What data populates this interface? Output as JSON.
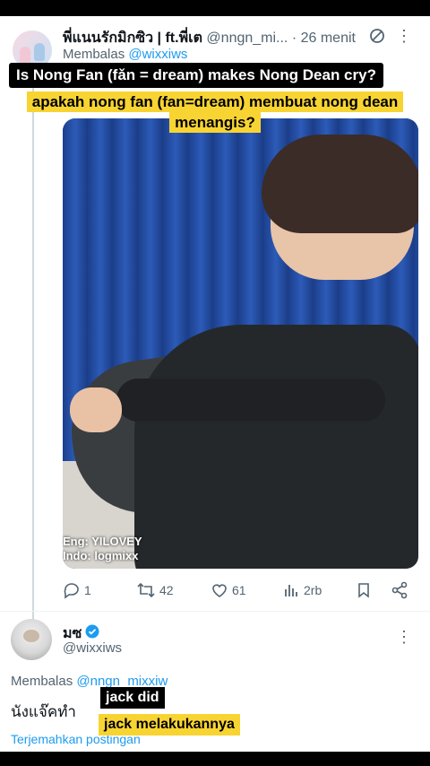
{
  "tweet1": {
    "display_name": "พี่แนนรักมิกซิว | ft.พี่เต",
    "handle": "@nngn_mi...",
    "time": "· 26 menit",
    "replying_prefix": "Membalas",
    "replying_to": "@wixxiws",
    "media_watermark_line1": "Eng: YILOVEY",
    "media_watermark_line2": "Indo: logmixx",
    "stats": {
      "replies": "1",
      "retweets": "42",
      "likes": "61",
      "views": "2rb"
    }
  },
  "captions": {
    "english_top": "Is Nong Fan (fǎn = dream) makes Nong Dean cry?",
    "indo_top_line1": "apakah nong fan (fan=dream) membuat nong dean",
    "indo_top_line2": "menangis?",
    "english_bottom": "jack did",
    "indo_bottom": "jack melakukannya"
  },
  "tweet2": {
    "display_name": "มซ",
    "handle": "@wixxiws",
    "replying_prefix": "Membalas",
    "replying_to": "@nngn_mixxiw",
    "body": "นังแจ๊คทำ",
    "translate": "Terjemahkan postingan"
  },
  "colors": {
    "accent": "#1d9bf0",
    "caption_yellow": "#f8d433",
    "caption_black": "#000000",
    "text_secondary": "#536471"
  },
  "icons": [
    "no-entry-icon",
    "more-icon",
    "reply-icon",
    "retweet-icon",
    "like-icon",
    "views-icon",
    "bookmark-icon",
    "share-icon",
    "verified-icon"
  ]
}
